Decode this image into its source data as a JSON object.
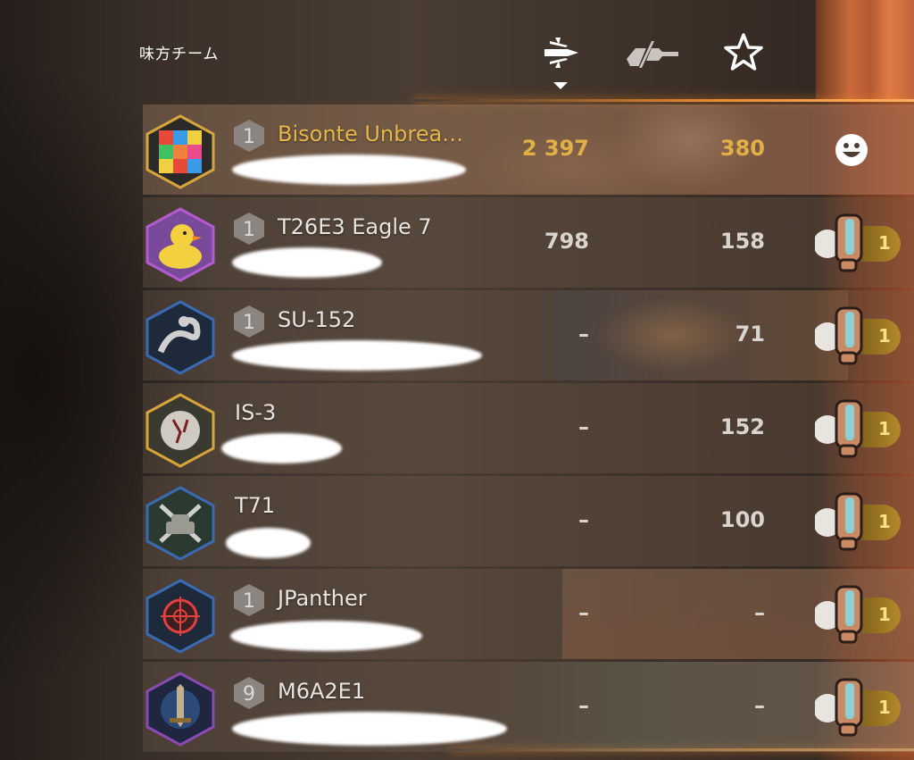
{
  "header": {
    "title": "味方チーム",
    "sort_column": "damage",
    "columns": [
      {
        "name": "damage",
        "icon": "damage-shell-icon"
      },
      {
        "name": "blocked",
        "icon": "blocked-damage-icon"
      },
      {
        "name": "experience",
        "icon": "star-icon"
      }
    ]
  },
  "accent_colors": {
    "gold": "#e2b146",
    "orange_line": "#ffa040",
    "text": "#e8e4df"
  },
  "players": [
    {
      "tank": "Bisonte Unbrea…",
      "tier_badge": "1",
      "damage": "2 397",
      "blocked": "380",
      "highlight": true,
      "reaction": "smiley"
    },
    {
      "tank": "T26E3 Eagle 7",
      "tier_badge": "1",
      "damage": "798",
      "blocked": "158",
      "highlight": false,
      "reaction": "dislike",
      "dislike_count": "1"
    },
    {
      "tank": "SU-152",
      "tier_badge": "1",
      "damage": "–",
      "blocked": "71",
      "highlight": false,
      "reaction": "dislike",
      "dislike_count": "1"
    },
    {
      "tank": "IS-3",
      "tier_badge": "",
      "damage": "–",
      "blocked": "152",
      "highlight": false,
      "reaction": "dislike",
      "dislike_count": "1"
    },
    {
      "tank": "T71",
      "tier_badge": "",
      "damage": "–",
      "blocked": "100",
      "highlight": false,
      "reaction": "dislike",
      "dislike_count": "1"
    },
    {
      "tank": "JPanther",
      "tier_badge": "1",
      "damage": "–",
      "blocked": "–",
      "highlight": false,
      "reaction": "dislike",
      "dislike_count": "1"
    },
    {
      "tank": "M6A2E1",
      "tier_badge": "9",
      "damage": "–",
      "blocked": "–",
      "highlight": false,
      "reaction": "dislike",
      "dislike_count": "1"
    }
  ],
  "avatar_icons": [
    "rubiks-cube-avatar-icon",
    "rubber-duck-avatar-icon",
    "snake-avatar-icon",
    "cracked-ball-avatar-icon",
    "crossed-guns-tank-avatar-icon",
    "target-scope-avatar-icon",
    "sword-avatar-icon"
  ]
}
